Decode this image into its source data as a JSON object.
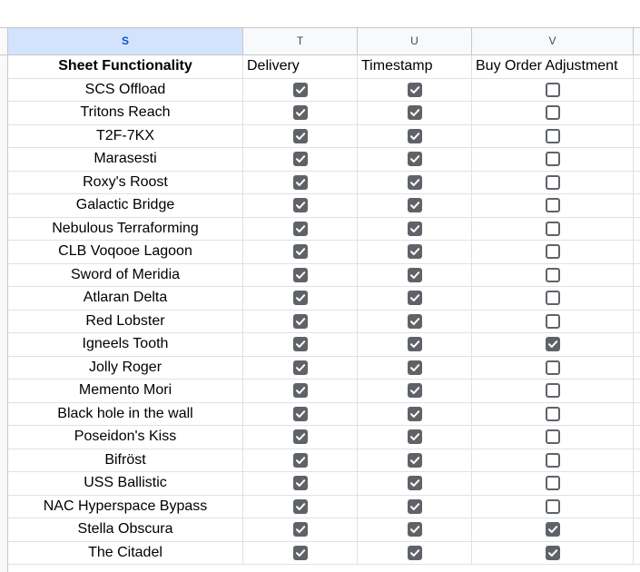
{
  "columns": {
    "s": "S",
    "t": "T",
    "u": "U",
    "v": "V"
  },
  "header": {
    "functionality": "Sheet Functionality",
    "delivery": "Delivery",
    "timestamp": "Timestamp",
    "buy_order": "Buy Order Adjustment"
  },
  "rows": [
    {
      "name": "SCS Offload",
      "delivery": true,
      "timestamp": true,
      "buy_order": false
    },
    {
      "name": "Tritons Reach",
      "delivery": true,
      "timestamp": true,
      "buy_order": false
    },
    {
      "name": "T2F-7KX",
      "delivery": true,
      "timestamp": true,
      "buy_order": false
    },
    {
      "name": "Marasesti",
      "delivery": true,
      "timestamp": true,
      "buy_order": false
    },
    {
      "name": "Roxy's Roost",
      "delivery": true,
      "timestamp": true,
      "buy_order": false
    },
    {
      "name": "Galactic Bridge",
      "delivery": true,
      "timestamp": true,
      "buy_order": false
    },
    {
      "name": "Nebulous Terraforming",
      "delivery": true,
      "timestamp": true,
      "buy_order": false
    },
    {
      "name": "CLB Voqooe Lagoon",
      "delivery": true,
      "timestamp": true,
      "buy_order": false
    },
    {
      "name": "Sword of Meridia",
      "delivery": true,
      "timestamp": true,
      "buy_order": false
    },
    {
      "name": "Atlaran Delta",
      "delivery": true,
      "timestamp": true,
      "buy_order": false
    },
    {
      "name": "Red Lobster",
      "delivery": true,
      "timestamp": true,
      "buy_order": false
    },
    {
      "name": "Igneels Tooth",
      "delivery": true,
      "timestamp": true,
      "buy_order": true
    },
    {
      "name": "Jolly Roger",
      "delivery": true,
      "timestamp": true,
      "buy_order": false
    },
    {
      "name": "Memento Mori",
      "delivery": true,
      "timestamp": true,
      "buy_order": false
    },
    {
      "name": "Black hole in the wall",
      "delivery": true,
      "timestamp": true,
      "buy_order": false
    },
    {
      "name": "Poseidon's Kiss",
      "delivery": true,
      "timestamp": true,
      "buy_order": false
    },
    {
      "name": "Bifröst",
      "delivery": true,
      "timestamp": true,
      "buy_order": false
    },
    {
      "name": "USS Ballistic",
      "delivery": true,
      "timestamp": true,
      "buy_order": false
    },
    {
      "name": "NAC Hyperspace Bypass",
      "delivery": true,
      "timestamp": true,
      "buy_order": false
    },
    {
      "name": "Stella Obscura",
      "delivery": true,
      "timestamp": true,
      "buy_order": true
    },
    {
      "name": "The Citadel",
      "delivery": true,
      "timestamp": true,
      "buy_order": true
    }
  ],
  "icons": {
    "checked": "checkbox-checked-icon",
    "unchecked": "checkbox-unchecked-icon"
  },
  "colors": {
    "selected_header_bg": "#d3e3fd",
    "selected_header_text": "#0b57d0",
    "checkbox": "#5f6368"
  }
}
